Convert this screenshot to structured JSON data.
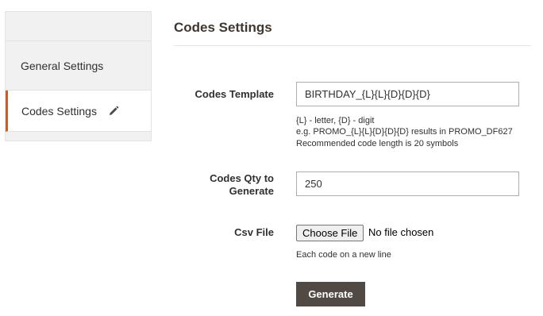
{
  "sidebar": {
    "items": [
      {
        "label": "General Settings",
        "active": false
      },
      {
        "label": "Codes Settings",
        "active": true,
        "icon": "pencil-icon"
      }
    ]
  },
  "main": {
    "title": "Codes Settings",
    "codes_template": {
      "label": "Codes Template",
      "value": "BIRTHDAY_{L}{L}{D}{D}{D}",
      "notes": [
        "{L} - letter, {D} - digit",
        "e.g. PROMO_{L}{L}{D}{D}{D} results in PROMO_DF627",
        "Recommended code length is 20 symbols"
      ]
    },
    "codes_qty": {
      "label_line1": "Codes Qty to",
      "label_line2": "Generate",
      "value": "250"
    },
    "csv_file": {
      "label": "Csv File",
      "button_label": "Choose File",
      "status": "No file chosen",
      "note": "Each code on a new line"
    },
    "generate_label": "Generate"
  },
  "colors": {
    "accent": "#eb5202",
    "button_dark": "#514943"
  }
}
